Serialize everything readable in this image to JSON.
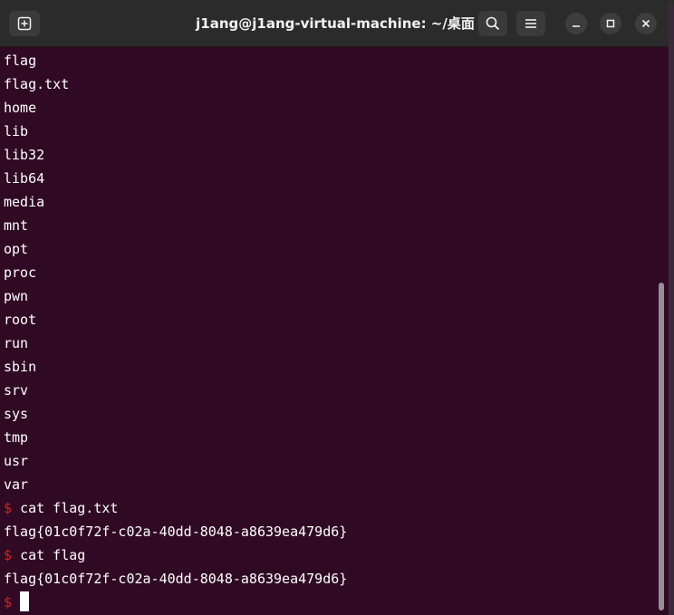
{
  "window": {
    "title": "j1ang@j1ang-virtual-machine: ~/桌面"
  },
  "icons": {
    "new_tab": "new-tab-icon",
    "search": "search-icon",
    "menu": "hamburger-menu-icon",
    "minimize": "minimize-icon",
    "maximize": "maximize-icon",
    "close": "close-icon"
  },
  "colors": {
    "terminal_bg": "#300a24",
    "titlebar_bg": "#2b2b2b",
    "text": "#ffffff",
    "prompt": "#d4231e"
  },
  "terminal": {
    "prompt_symbol": "$",
    "lines": [
      {
        "type": "output",
        "text": "flag"
      },
      {
        "type": "output",
        "text": "flag.txt"
      },
      {
        "type": "output",
        "text": "home"
      },
      {
        "type": "output",
        "text": "lib"
      },
      {
        "type": "output",
        "text": "lib32"
      },
      {
        "type": "output",
        "text": "lib64"
      },
      {
        "type": "output",
        "text": "media"
      },
      {
        "type": "output",
        "text": "mnt"
      },
      {
        "type": "output",
        "text": "opt"
      },
      {
        "type": "output",
        "text": "proc"
      },
      {
        "type": "output",
        "text": "pwn"
      },
      {
        "type": "output",
        "text": "root"
      },
      {
        "type": "output",
        "text": "run"
      },
      {
        "type": "output",
        "text": "sbin"
      },
      {
        "type": "output",
        "text": "srv"
      },
      {
        "type": "output",
        "text": "sys"
      },
      {
        "type": "output",
        "text": "tmp"
      },
      {
        "type": "output",
        "text": "usr"
      },
      {
        "type": "output",
        "text": "var"
      },
      {
        "type": "command",
        "text": "cat flag.txt"
      },
      {
        "type": "output",
        "text": "flag{01c0f72f-c02a-40dd-8048-a8639ea479d6}"
      },
      {
        "type": "command",
        "text": "cat flag"
      },
      {
        "type": "output",
        "text": "flag{01c0f72f-c02a-40dd-8048-a8639ea479d6}"
      }
    ],
    "current_input": ""
  }
}
